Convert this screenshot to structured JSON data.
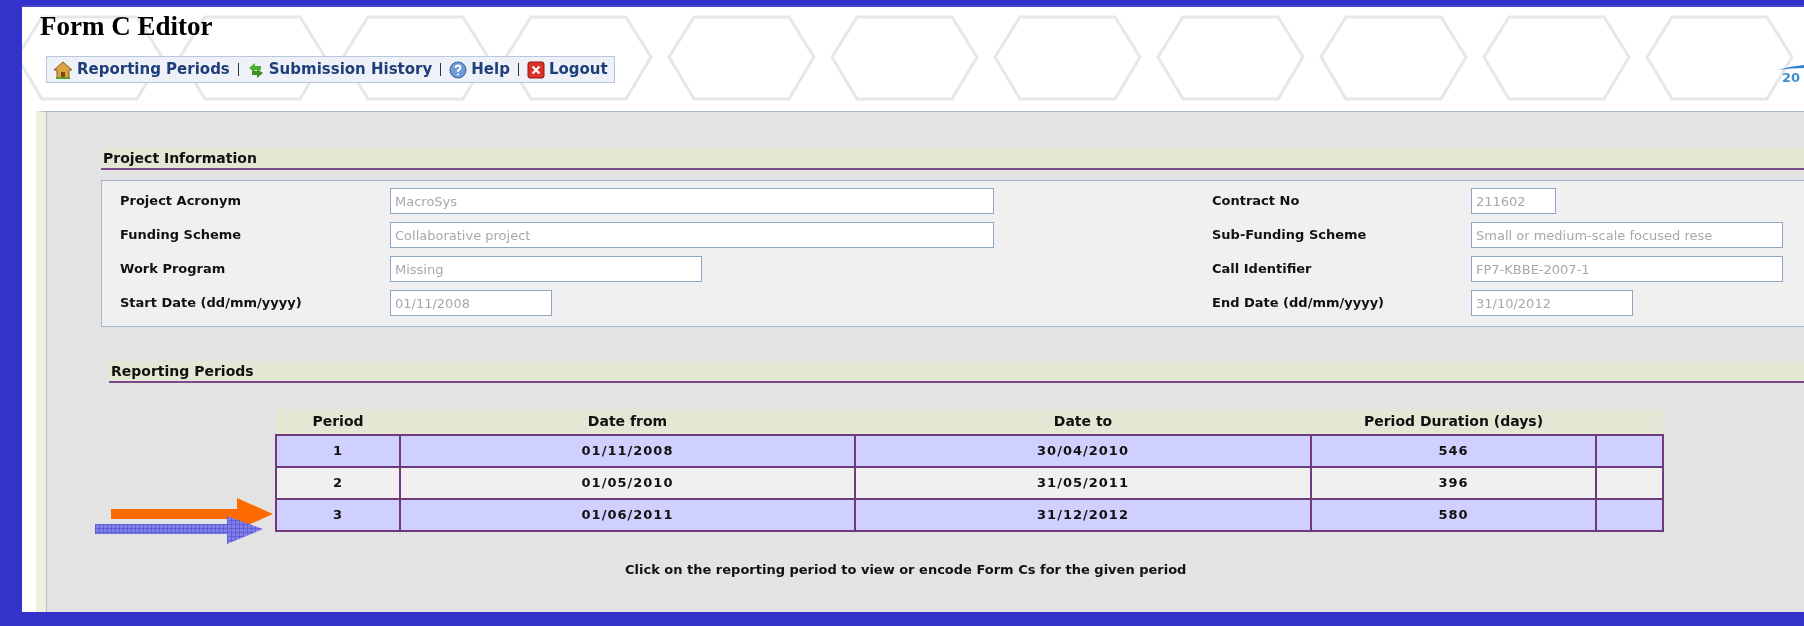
{
  "window": {
    "title": "Form C Editor"
  },
  "nav": [
    {
      "kind": "home",
      "label": "Reporting Periods"
    },
    {
      "kind": "history",
      "label": "Submission History"
    },
    {
      "kind": "help",
      "label": "Help"
    },
    {
      "kind": "logout",
      "label": "Logout"
    }
  ],
  "logo_text": "20",
  "project_information": {
    "title": "Project Information",
    "left": [
      {
        "label": "Project Acronym",
        "value": "MacroSys"
      },
      {
        "label": "Funding Scheme",
        "value": "Collaborative project"
      },
      {
        "label": "Work Program",
        "value": "Missing"
      },
      {
        "label": "Start Date (dd/mm/yyyy)",
        "value": "01/11/2008"
      }
    ],
    "right": [
      {
        "label": "Contract No",
        "value": "211602"
      },
      {
        "label": "Sub-Funding Scheme",
        "value": "Small or medium-scale focused rese"
      },
      {
        "label": "Call Identifier",
        "value": "FP7-KBBE-2007-1"
      },
      {
        "label": "End Date (dd/mm/yyyy)",
        "value": "31/10/2012"
      }
    ]
  },
  "reporting_periods": {
    "title": "Reporting Periods",
    "table": {
      "columns": [
        "Period",
        "Date from",
        "Date to",
        "Period Duration (days)"
      ],
      "rows": [
        [
          "1",
          "01/11/2008",
          "30/04/2010",
          "546"
        ],
        [
          "2",
          "01/05/2010",
          "31/05/2011",
          "396"
        ],
        [
          "3",
          "01/06/2011",
          "31/12/2012",
          "580"
        ]
      ]
    },
    "note": "Click on the reporting period to view or encode Form Cs for the given period"
  }
}
